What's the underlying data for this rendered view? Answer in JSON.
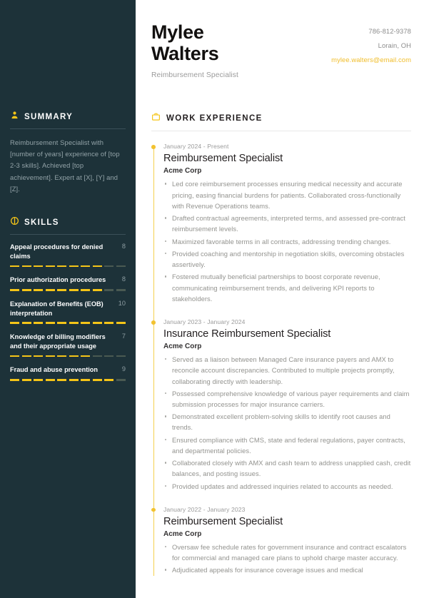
{
  "header": {
    "first_name": "Mylee",
    "last_name": "Walters",
    "job_title": "Reimbursement Specialist",
    "phone": "786-812-9378",
    "location": "Lorain, OH",
    "email": "mylee.walters@email.com"
  },
  "theme": {
    "sidebar_bg": "#1d3239",
    "accent": "#f5c518",
    "email_color": "#f0bd2a",
    "sidebar_text": "#93a3a8"
  },
  "sidebar": {
    "summary": {
      "icon": "person-icon",
      "title": "SUMMARY",
      "text": "Reimbursement Specialist with [number of years] experience of [top 2-3 skills]. Achieved [top achievement]. Expert at [X], [Y] and [Z]."
    },
    "skills": {
      "icon": "skill-gauge-icon",
      "title": "SKILLS",
      "max_rating": 10,
      "items": [
        {
          "name": "Appeal procedures for denied claims",
          "rating": 8
        },
        {
          "name": "Prior authorization procedures",
          "rating": 8
        },
        {
          "name": "Explanation of Benefits (EOB) interpretation",
          "rating": 10
        },
        {
          "name": "Knowledge of billing modifiers and their appropriate usage",
          "rating": 7
        },
        {
          "name": "Fraud and abuse prevention",
          "rating": 9
        }
      ]
    }
  },
  "work_experience": {
    "icon": "briefcase-icon",
    "title": "WORK EXPERIENCE",
    "jobs": [
      {
        "dates": "January 2024 - Present",
        "role": "Reimbursement Specialist",
        "company": "Acme Corp",
        "bullets": [
          "Led core reimbursement processes ensuring medical necessity and accurate pricing, easing financial burdens for patients. Collaborated cross-functionally with Revenue Operations teams.",
          "Drafted contractual agreements, interpreted terms, and assessed pre-contract reimbursement levels.",
          "Maximized favorable terms in all contracts, addressing trending changes.",
          "Provided coaching and mentorship in negotiation skills, overcoming obstacles assertively.",
          "Fostered mutually beneficial partnerships to boost corporate revenue, communicating reimbursement trends, and delivering KPI reports to stakeholders."
        ]
      },
      {
        "dates": "January 2023 - January 2024",
        "role": "Insurance Reimbursement Specialist",
        "company": "Acme Corp",
        "bullets": [
          "Served as a liaison between Managed Care insurance payers and AMX to reconcile account discrepancies. Contributed to multiple projects promptly, collaborating directly with leadership.",
          "Possessed comprehensive knowledge of various payer requirements and claim submission processes for major insurance carriers.",
          "Demonstrated excellent problem-solving skills to identify root causes and trends.",
          "Ensured compliance with CMS, state and federal regulations, payer contracts, and departmental policies.",
          "Collaborated closely with AMX and cash team to address unapplied cash, credit balances, and posting issues.",
          "Provided updates and addressed inquiries related to accounts as needed."
        ]
      },
      {
        "dates": "January 2022 - January 2023",
        "role": "Reimbursement Specialist",
        "company": "Acme Corp",
        "bullets": [
          "Oversaw fee schedule rates for government insurance and contract escalators for commercial and managed care plans to uphold charge master accuracy.",
          "Adjudicated appeals for insurance coverage issues and medical"
        ]
      }
    ]
  }
}
